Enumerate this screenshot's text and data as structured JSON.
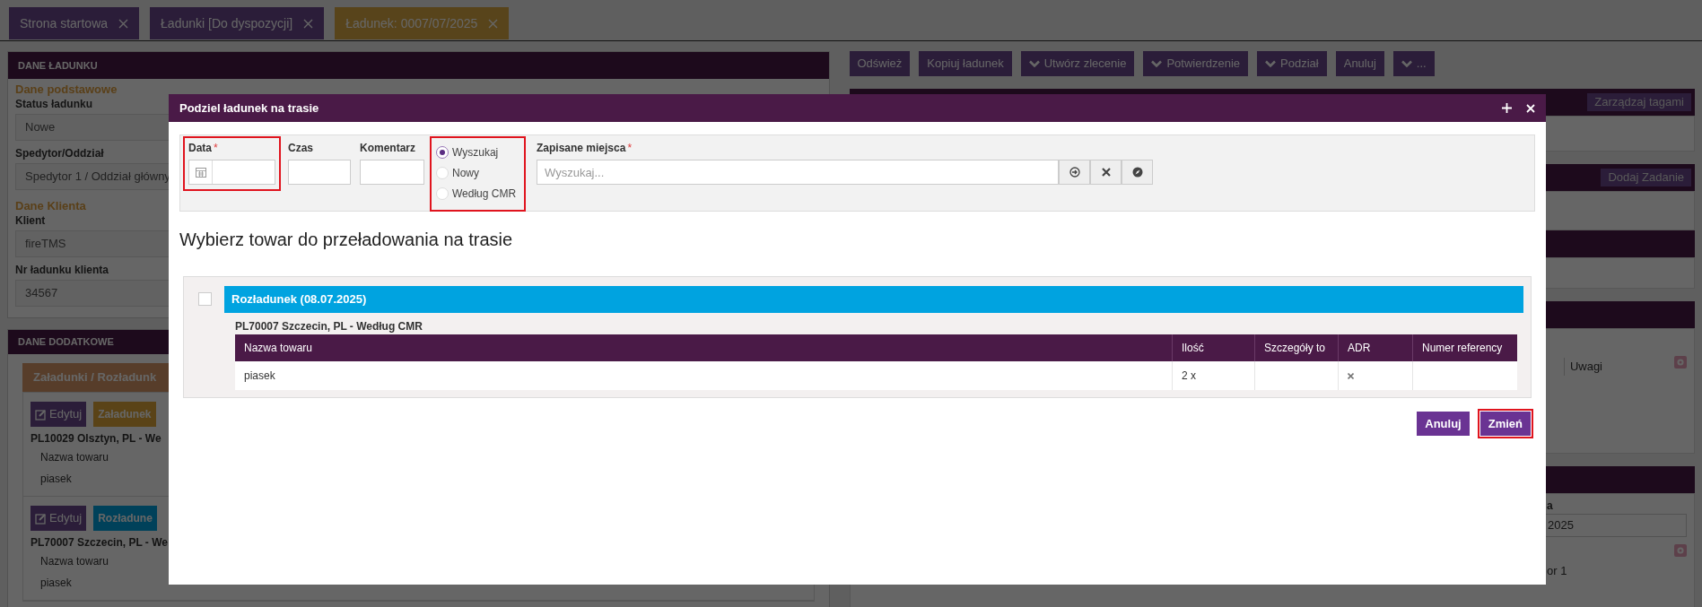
{
  "tabs": [
    {
      "label": "Strona startowa",
      "selected": false
    },
    {
      "label": "Ładunki [Do dyspozycji]",
      "selected": false
    },
    {
      "label": "Ładunek: 0007/07/2025",
      "selected": true
    }
  ],
  "toolbar": [
    {
      "label": "Odśwież",
      "dropdown": false
    },
    {
      "label": "Kopiuj ładunek",
      "dropdown": false
    },
    {
      "label": "Utwórz zlecenie",
      "dropdown": true
    },
    {
      "label": "Potwierdzenie",
      "dropdown": true
    },
    {
      "label": "Podział",
      "dropdown": true
    },
    {
      "label": "Anuluj",
      "dropdown": false
    },
    {
      "label": "...",
      "dropdown": true
    }
  ],
  "load_panel": {
    "title": "DANE ŁADUNKU",
    "groups": [
      {
        "heading": "Dane podstawowe",
        "fields": [
          {
            "label": "Status ładunku",
            "value": "Nowe"
          },
          {
            "label": "Spedytor/Oddział",
            "value": "Spedytor 1 / Oddział główny"
          }
        ]
      },
      {
        "heading": "Dane Klienta",
        "fields": [
          {
            "label": "Klient",
            "value": "fireTMS"
          },
          {
            "label": "Nr ładunku klienta",
            "value": "34567"
          }
        ]
      }
    ]
  },
  "additional_panel": {
    "title": "DANE DODATKOWE",
    "tab": "Załadunki / Rozładunk",
    "cards": [
      {
        "edit": "Edytuj",
        "badge": "Załadunek",
        "kind": "loading",
        "location": "PL10029 Olsztyn, PL - We",
        "column": "Nazwa towaru",
        "item": "piasek"
      },
      {
        "edit": "Edytuj",
        "badge": "Rozładune",
        "kind": "unloading",
        "location": "PL70007 Szczecin, PL - We",
        "column": "Nazwa towaru",
        "item": "piasek"
      }
    ]
  },
  "right_panel": {
    "tags_button": "Zarządzaj tagami",
    "task_button": "Dodaj Zadanie",
    "notes_label": "Uwagi",
    "field_label": "a",
    "field_value": "2025",
    "text": "or 1"
  },
  "dialog": {
    "title": "Podziel ładunek na trasie",
    "fields": [
      {
        "label": "Data",
        "required_mark": "*",
        "kind": "date",
        "highlighted": true
      },
      {
        "label": "Czas",
        "kind": "text",
        "highlighted": false
      },
      {
        "label": "Komentarz",
        "kind": "text",
        "highlighted": false
      }
    ],
    "mode": {
      "highlighted": true,
      "options": [
        {
          "label": "Wyszukaj",
          "selected": true
        },
        {
          "label": "Nowy",
          "selected": false
        },
        {
          "label": "Według CMR",
          "selected": false
        }
      ]
    },
    "saved_places": {
      "label": "Zapisane miejsca",
      "required_mark": "*",
      "placeholder": "Wyszukaj..."
    },
    "heading": "Wybierz towar do przeładowania na trasie",
    "group": {
      "checked": false,
      "title": "Rozładunek (08.07.2025)",
      "location": "PL70007 Szczecin, PL - Według CMR",
      "columns": [
        "Nazwa towaru",
        "Ilość",
        "Szczegóły to",
        "ADR",
        "Numer referency"
      ],
      "rows": [
        {
          "name": "piasek",
          "quantity": "2 x",
          "adr": false
        }
      ]
    },
    "buttons": [
      {
        "label": "Anuluj",
        "highlighted": false
      },
      {
        "label": "Zmień",
        "highlighted": true
      }
    ]
  }
}
